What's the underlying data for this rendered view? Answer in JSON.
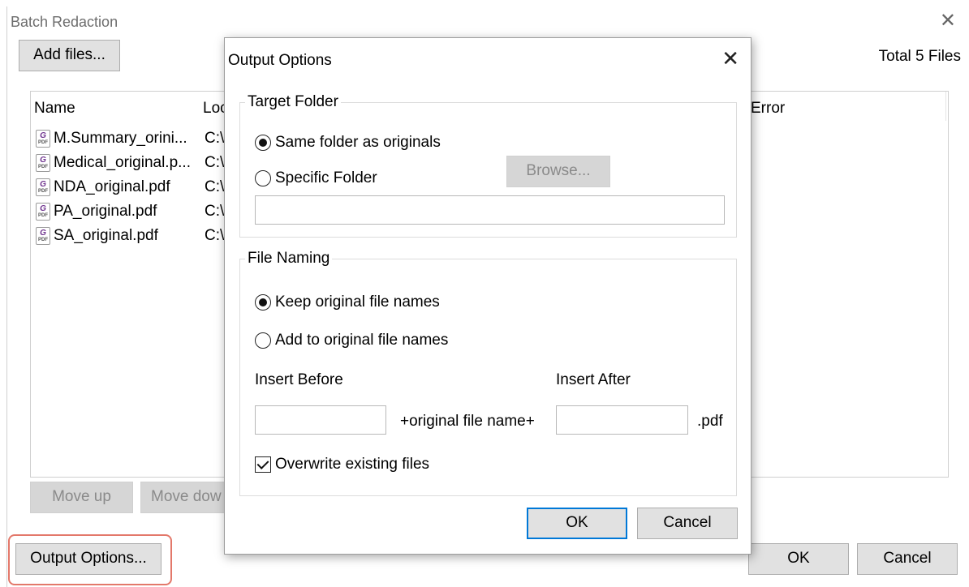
{
  "main": {
    "title": "Batch Redaction",
    "add_files_label": "Add files...",
    "total_files": "Total 5 Files",
    "columns": {
      "name": "Name",
      "location": "Loc",
      "error": "Error"
    },
    "files": [
      {
        "name": "M.Summary_orini...",
        "location": "C:\\"
      },
      {
        "name": "Medical_original.p...",
        "location": "C:\\"
      },
      {
        "name": "NDA_original.pdf",
        "location": "C:\\"
      },
      {
        "name": "PA_original.pdf",
        "location": "C:\\"
      },
      {
        "name": "SA_original.pdf",
        "location": "C:\\"
      }
    ],
    "move_up_label": "Move up",
    "move_down_label": "Move dow",
    "output_options_label": "Output Options...",
    "ok_label": "OK",
    "cancel_label": "Cancel",
    "close_glyph": "✕"
  },
  "dialog": {
    "title": "Output Options",
    "close_glyph": "✕",
    "target_folder": {
      "legend": "Target Folder",
      "same_folder_label": "Same folder as originals",
      "same_folder_selected": true,
      "specific_folder_label": "Specific Folder",
      "browse_label": "Browse...",
      "folder_path": ""
    },
    "file_naming": {
      "legend": "File Naming",
      "keep_names_label": "Keep original file names",
      "keep_names_selected": true,
      "add_names_label": "Add to original file names",
      "insert_before_label": "Insert Before",
      "insert_after_label": "Insert After",
      "insert_before_value": "",
      "insert_after_value": "",
      "middle_text": "+original file name+",
      "extension": ".pdf",
      "overwrite_label": "Overwrite existing files",
      "overwrite_checked": true
    },
    "ok_label": "OK",
    "cancel_label": "Cancel"
  },
  "icons": {
    "pdf_glyph": "G",
    "pdf_caption": "PDF"
  },
  "colors": {
    "highlight": "#e3786a",
    "focus_border": "#0078d7"
  }
}
